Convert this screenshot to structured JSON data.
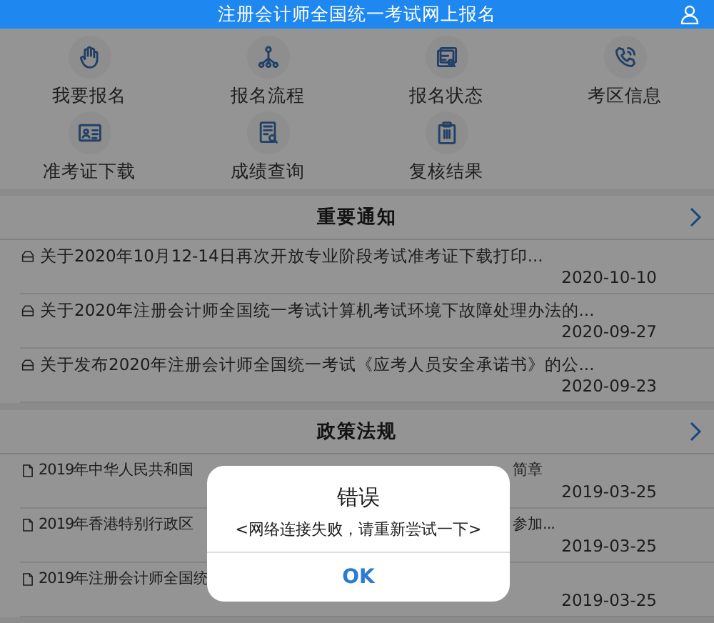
{
  "header": {
    "title": "注册会计师全国统一考试网上报名"
  },
  "menu": [
    {
      "label": "我要报名",
      "kind": "hand"
    },
    {
      "label": "报名流程",
      "kind": "flow"
    },
    {
      "label": "报名状态",
      "kind": "status"
    },
    {
      "label": "考区信息",
      "kind": "phone"
    },
    {
      "label": "准考证下载",
      "kind": "card"
    },
    {
      "label": "成绩查询",
      "kind": "score"
    },
    {
      "label": "复核结果",
      "kind": "clipboard"
    }
  ],
  "sections": [
    {
      "title": "重要通知",
      "kind": "notice",
      "items": [
        {
          "text": "关于2020年10月12-14日再次开放专业阶段考试准考证下载打印...",
          "date": "2020-10-10"
        },
        {
          "text": "关于2020年注册会计师全国统一考试计算机考试环境下故障处理办法的...",
          "date": "2020-09-27"
        },
        {
          "text": "关于发布2020年注册会计师全国统一考试《应考人员安全承诺书》的公...",
          "date": "2020-09-23"
        }
      ]
    },
    {
      "title": "政策法规",
      "kind": "policy",
      "items": [
        {
          "text": "2019年中华人民共和国",
          "text_end": "简章",
          "date": "2019-03-25"
        },
        {
          "text": "2019年香港特别行政区",
          "text_end": "参加...",
          "date": "2019-03-25"
        },
        {
          "text": "2019年注册会计师全国统",
          "date": "2019-03-25"
        }
      ]
    }
  ],
  "dialog": {
    "title": "错误",
    "message": "<网络连接失败，请重新尝试一下>",
    "button": "OK"
  }
}
